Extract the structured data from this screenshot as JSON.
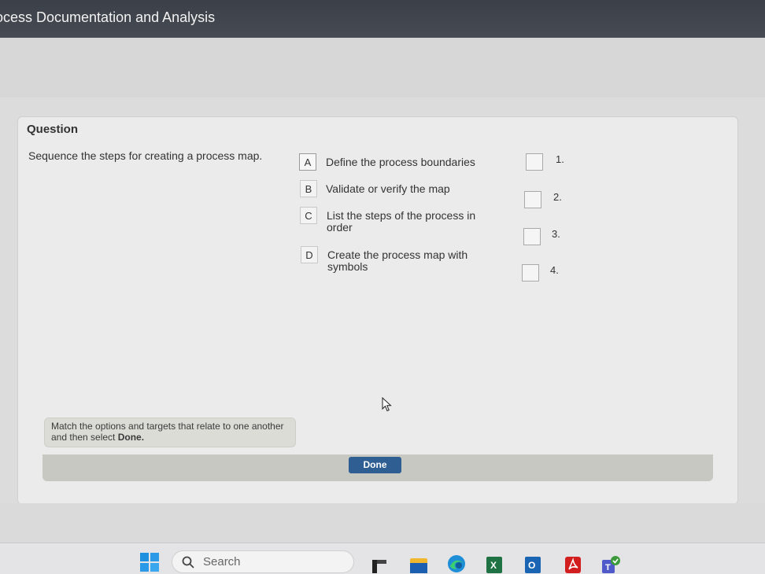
{
  "window": {
    "title": "ocess Documentation and Analysis"
  },
  "question": {
    "heading": "Question",
    "prompt": "Sequence the steps for creating a process map."
  },
  "options": [
    {
      "letter": "A",
      "text": "Define the process boundaries"
    },
    {
      "letter": "B",
      "text": "Validate or verify the map"
    },
    {
      "letter": "C",
      "text": "List the steps of the process in order"
    },
    {
      "letter": "D",
      "text": "Create the process map with symbols"
    }
  ],
  "targets": [
    "1.",
    "2.",
    "3.",
    "4."
  ],
  "instruction": {
    "text": "Match the options and targets that relate to one another and then select ",
    "emphasis": "Done."
  },
  "done_label": "Done",
  "taskbar": {
    "search_label": "Search",
    "apps": [
      "start-icon",
      "file-explorer-icon",
      "file-manager-icon",
      "edge-icon",
      "excel-icon",
      "outlook-icon",
      "acrobat-icon",
      "teams-icon"
    ]
  },
  "colors": {
    "title_bar": "#3b3f47",
    "done_button": "#2f5e93",
    "excel": "#1f7244",
    "outlook": "#1a64b4",
    "acrobat": "#d21e1e",
    "teams": "#5059c9"
  }
}
